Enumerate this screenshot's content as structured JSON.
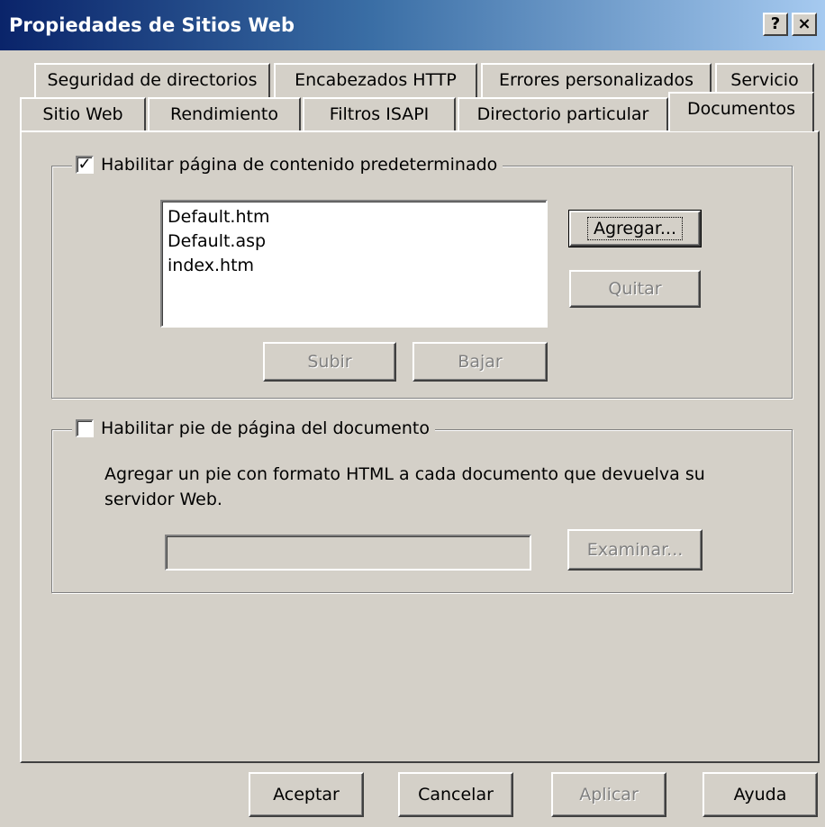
{
  "window": {
    "title": "Propiedades de Sitios Web",
    "help_button": "?",
    "close_button": "×"
  },
  "tabs_row1": [
    {
      "label": "Seguridad de directorios"
    },
    {
      "label": "Encabezados HTTP"
    },
    {
      "label": "Errores personalizados"
    },
    {
      "label": "Servicio"
    }
  ],
  "tabs_row2": [
    {
      "label": "Sitio Web"
    },
    {
      "label": "Rendimiento"
    },
    {
      "label": "Filtros ISAPI"
    },
    {
      "label": "Directorio particular"
    },
    {
      "label": "Documentos",
      "active": true
    }
  ],
  "default_content": {
    "checkbox_label": "Habilitar página de contenido predeterminado",
    "checked": true,
    "documents": [
      "Default.htm",
      "Default.asp",
      "index.htm"
    ],
    "add_button": "Agregar...",
    "remove_button": "Quitar",
    "up_button": "Subir",
    "down_button": "Bajar"
  },
  "footer": {
    "checkbox_label": "Habilitar pie de página del documento",
    "checked": false,
    "description": "Agregar un pie con formato HTML a cada documento que devuelva su servidor Web.",
    "path_value": "",
    "browse_button": "Examinar..."
  },
  "dialog_buttons": {
    "ok": "Aceptar",
    "cancel": "Cancelar",
    "apply": "Aplicar",
    "help": "Ayuda"
  }
}
